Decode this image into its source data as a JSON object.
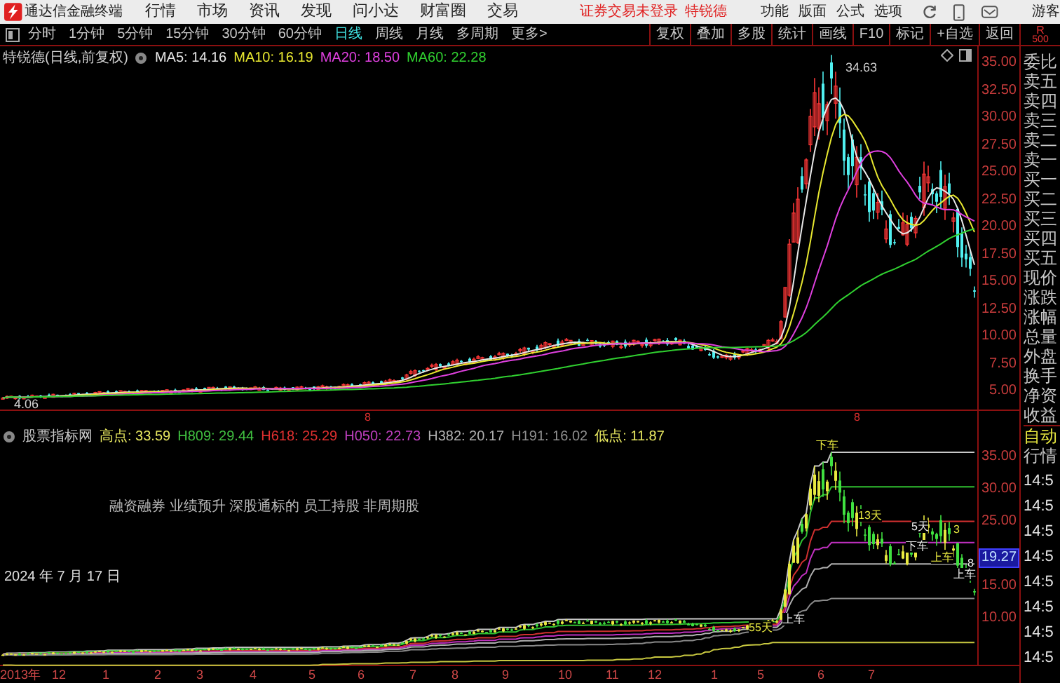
{
  "menu_bar": {
    "app_title": "通达信金融终端",
    "menus": [
      "行情",
      "市场",
      "资讯",
      "发现",
      "问小达",
      "财富圈",
      "交易"
    ],
    "login_status": "证券交易未登录",
    "stock_name": "特锐德",
    "tools": [
      "功能",
      "版面",
      "公式",
      "选项"
    ],
    "user": "游客"
  },
  "period_tabs": [
    {
      "label": "分时",
      "selected": false
    },
    {
      "label": "1分钟",
      "selected": false
    },
    {
      "label": "5分钟",
      "selected": false
    },
    {
      "label": "15分钟",
      "selected": false
    },
    {
      "label": "30分钟",
      "selected": false
    },
    {
      "label": "60分钟",
      "selected": false
    },
    {
      "label": "日线",
      "selected": true
    },
    {
      "label": "周线",
      "selected": false
    },
    {
      "label": "月线",
      "selected": false
    },
    {
      "label": "多周期",
      "selected": false
    },
    {
      "label": "更多>",
      "selected": false
    }
  ],
  "chart_tools": [
    "复权",
    "叠加",
    "多股",
    "统计",
    "画线",
    "F10",
    "标记",
    "+自选",
    "返回"
  ],
  "corner_badge": {
    "letter": "R",
    "number": "500"
  },
  "main_chart": {
    "title": "特锐德(日线,前复权)",
    "moving_averages": [
      {
        "label": "MA5: 14.16",
        "color": "#e8e8e8"
      },
      {
        "label": "MA10: 16.19",
        "color": "#e8e830"
      },
      {
        "label": "MA20: 18.50",
        "color": "#e040e0"
      },
      {
        "label": "MA60: 22.28",
        "color": "#30d030"
      }
    ],
    "peak_label": "34.63",
    "low_label": "4.06",
    "price_ticks": [
      "35.00",
      "32.50",
      "30.00",
      "27.50",
      "25.00",
      "22.50",
      "20.00",
      "17.50",
      "15.00",
      "12.50",
      "10.00",
      "7.50",
      "5.00"
    ],
    "event_marks": [
      "8",
      "8"
    ]
  },
  "indicator": {
    "name": "股票指标网",
    "values": [
      {
        "label": "高点: 33.59",
        "color": "#e8e860"
      },
      {
        "label": "H809: 29.44",
        "color": "#40c040"
      },
      {
        "label": "H618: 25.29",
        "color": "#e03030"
      },
      {
        "label": "H050: 22.73",
        "color": "#c040c0"
      },
      {
        "label": "H382: 20.17",
        "color": "#b0b0b0"
      },
      {
        "label": "H191: 16.02",
        "color": "#909090"
      },
      {
        "label": "低点: 11.87",
        "color": "#e8e860"
      }
    ],
    "tags": "融资融券 业绩预升 深股通标的 员工持股 非周期股",
    "date": "2024 年 7 月 17 日",
    "ticks": [
      "35.00",
      "30.00",
      "25.00",
      "15.00",
      "10.00"
    ],
    "current_value": "19.27",
    "signals": [
      "下车",
      "下车",
      "13天",
      "5天",
      "3",
      "8",
      "上车",
      "上车",
      "55天",
      "上车"
    ]
  },
  "time_axis": [
    "2013年",
    "12",
    "1",
    "2",
    "3",
    "4",
    "5",
    "6",
    "7",
    "8",
    "9",
    "10",
    "11",
    "12",
    "1",
    "5",
    "6",
    "7"
  ],
  "quote_panel": {
    "fields": [
      "委比",
      "卖五",
      "卖四",
      "卖三",
      "卖二",
      "卖一",
      "买一",
      "买二",
      "买三",
      "买四",
      "买五",
      "现价",
      "涨跌",
      "涨幅",
      "总量",
      "外盘",
      "换手",
      "净资",
      "收益"
    ],
    "mode": "自动",
    "section": "行情",
    "times": [
      "14:5",
      "14:5",
      "14:5",
      "14:5",
      "14:5",
      "14:5",
      "14:5",
      "14:5"
    ]
  }
}
